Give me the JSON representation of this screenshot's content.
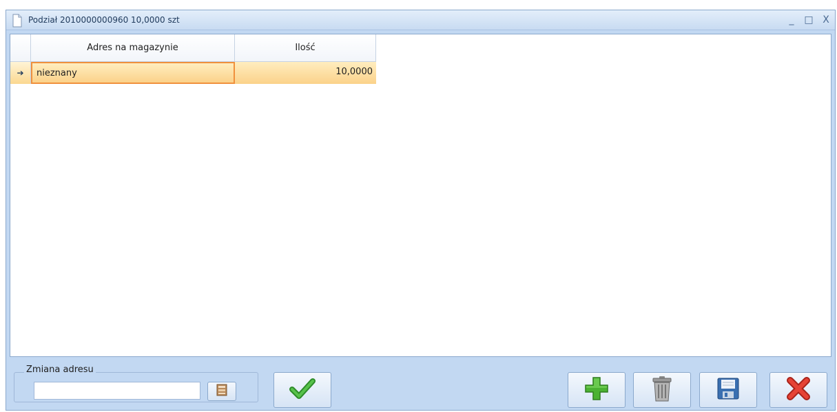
{
  "window": {
    "title": "Podział 2010000000960 10,0000 szt",
    "minimize_glyph": "_",
    "maximize_glyph": "□",
    "close_glyph": "X"
  },
  "grid": {
    "columns": [
      "Adres na magazynie",
      "Ilość"
    ],
    "rows": [
      {
        "indicator": "➔",
        "address": "nieznany",
        "quantity": "10,0000"
      }
    ]
  },
  "address_change": {
    "legend": "Zmiana adresu",
    "value": "",
    "placeholder": ""
  },
  "icons": {
    "title": "document-icon",
    "browse": "shelf-icon",
    "confirm": "checkmark-icon",
    "add": "plus-icon",
    "delete": "trash-icon",
    "save": "floppy-disk-icon",
    "cancel": "red-x-icon"
  },
  "colors": {
    "confirm_green": "#3aa335",
    "add_green": "#4bb232",
    "cancel_red": "#e03a2c",
    "selection_border": "#f0903c"
  }
}
